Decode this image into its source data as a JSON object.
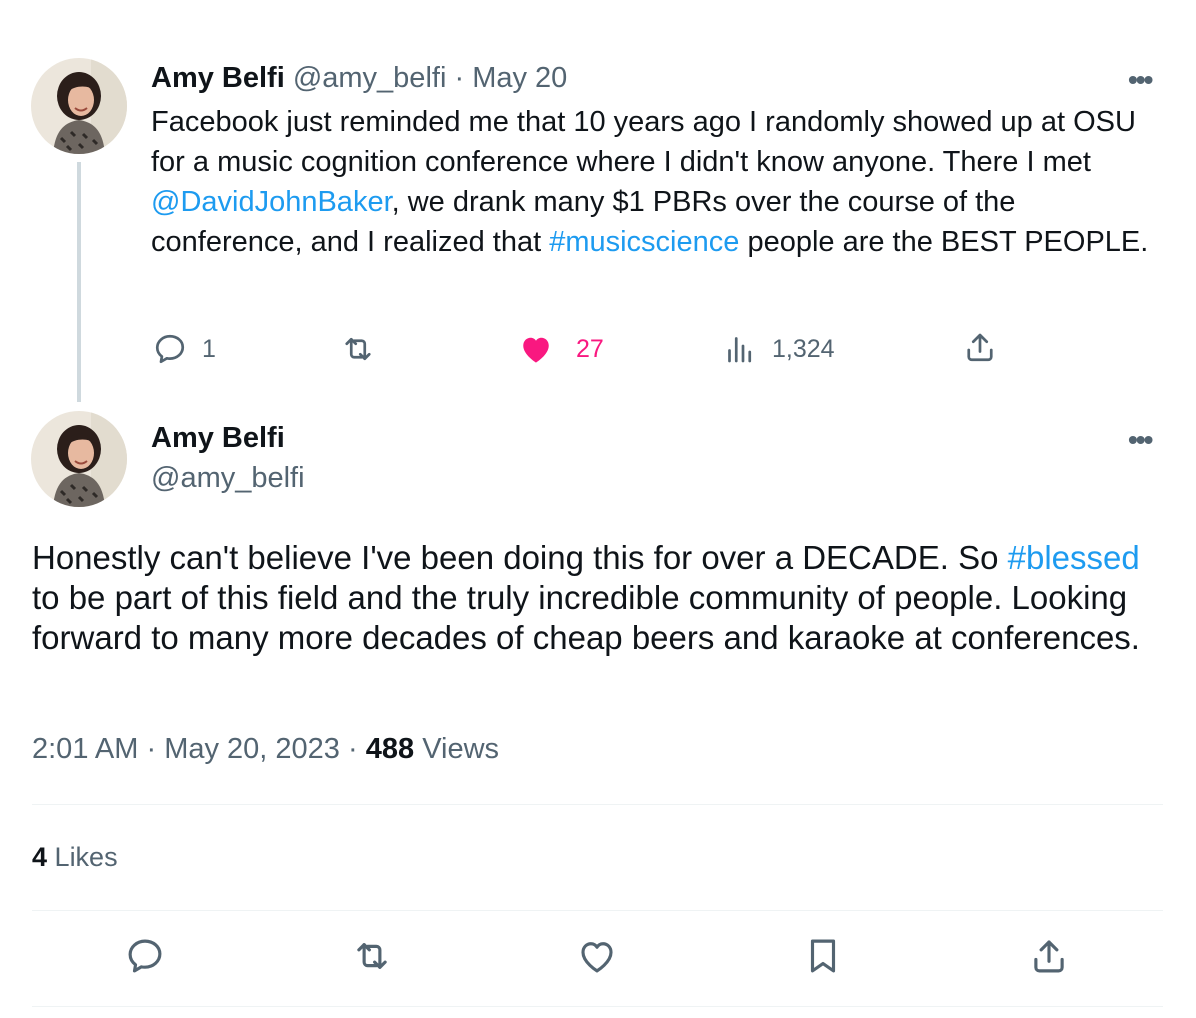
{
  "tweet1": {
    "display_name": "Amy Belfi",
    "handle": "@amy_belfi",
    "separator": "·",
    "date": "May 20",
    "text_before_mention": "Facebook just reminded me that 10 years ago I randomly showed up at OSU for a music cognition conference where I didn't know anyone. There I met ",
    "mention": "@DavidJohnBaker",
    "text_middle": ", we drank many $1 PBRs over the course of the conference, and I realized that ",
    "hashtag": "#musicscience",
    "text_after": " people are the BEST PEOPLE.",
    "more_label": "•••",
    "replies": "1",
    "likes": "27",
    "views": "1,324",
    "liked_color": "#f91880"
  },
  "tweet2": {
    "display_name": "Amy Belfi",
    "handle": "@amy_belfi",
    "more_label": "•••",
    "text_before_hashtag": "Honestly can't believe I've been doing this for over a DECADE. So ",
    "hashtag": "#blessed",
    "text_after": " to be part of this field and the truly incredible community of people. Looking forward to many more decades of cheap beers and karaoke at conferences.",
    "time": "2:01 AM",
    "sep1": "·",
    "date": "May 20, 2023",
    "sep2": "·",
    "views_count": "488",
    "views_label": "Views",
    "likes_count": "4",
    "likes_label": "Likes"
  },
  "colors": {
    "link": "#1d9bf0",
    "muted": "#536471",
    "text": "#0f1419",
    "like": "#f91880"
  }
}
